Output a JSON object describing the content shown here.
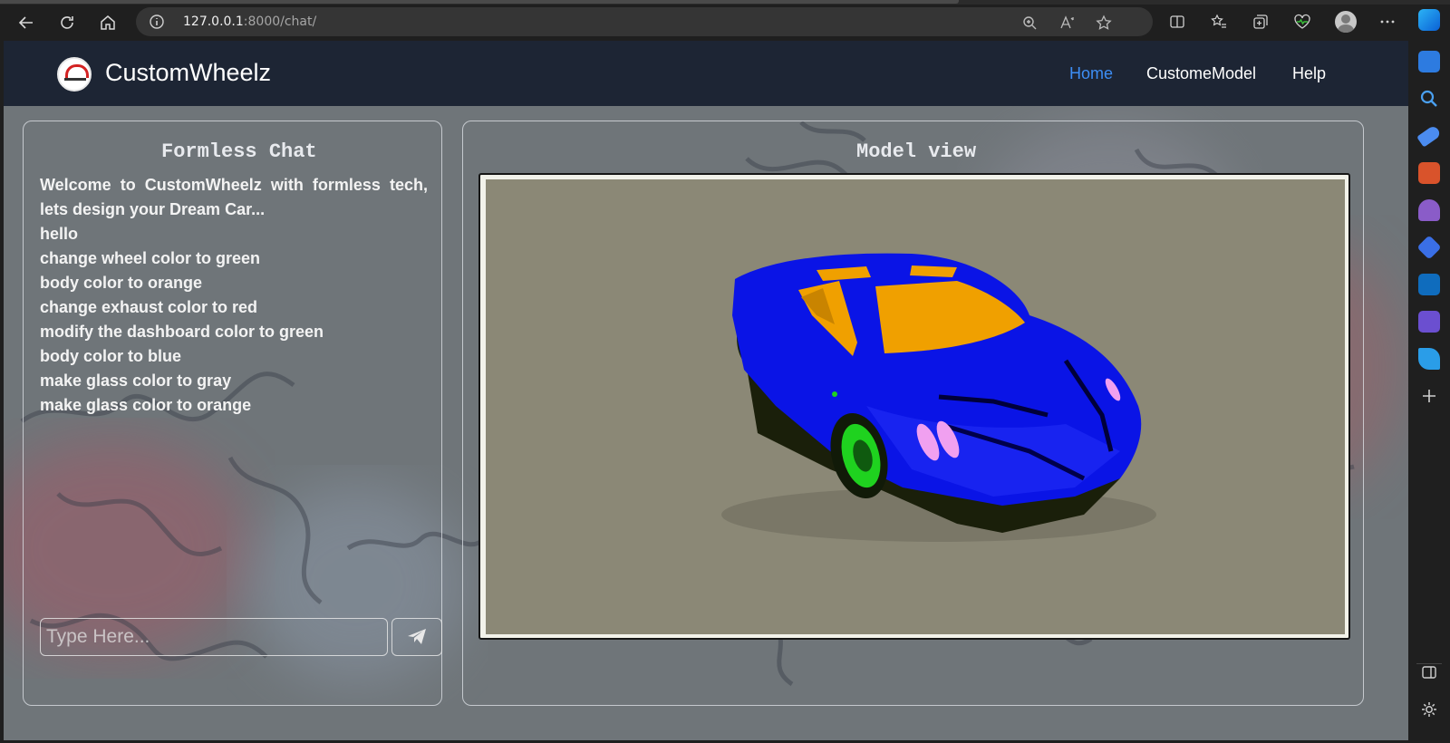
{
  "browser": {
    "url_host": "127.0.0.1",
    "url_path": ":8000/chat/"
  },
  "app": {
    "brand": "CustomWheelz",
    "nav": [
      "Home",
      "CustomeModel",
      "Help"
    ],
    "active_nav": "Home"
  },
  "chat": {
    "title": "Formless Chat",
    "messages": [
      "Welcome to CustomWheelz with formless tech, lets design your Dream Car...",
      "hello",
      "change wheel color to green",
      "body color to orange",
      "change exhaust color to red",
      "modify the dashboard color to green",
      "body color to blue",
      "make glass color to gray",
      "make glass color to orange"
    ],
    "input_placeholder": "Type Here..."
  },
  "model": {
    "title": "Model view",
    "body_color": "#0a14e6",
    "glass_color": "#f0a000",
    "wheel_color": "#1fd21f"
  },
  "colors": {
    "navbar": "#1d2534",
    "active_link": "#3d8ef5"
  }
}
